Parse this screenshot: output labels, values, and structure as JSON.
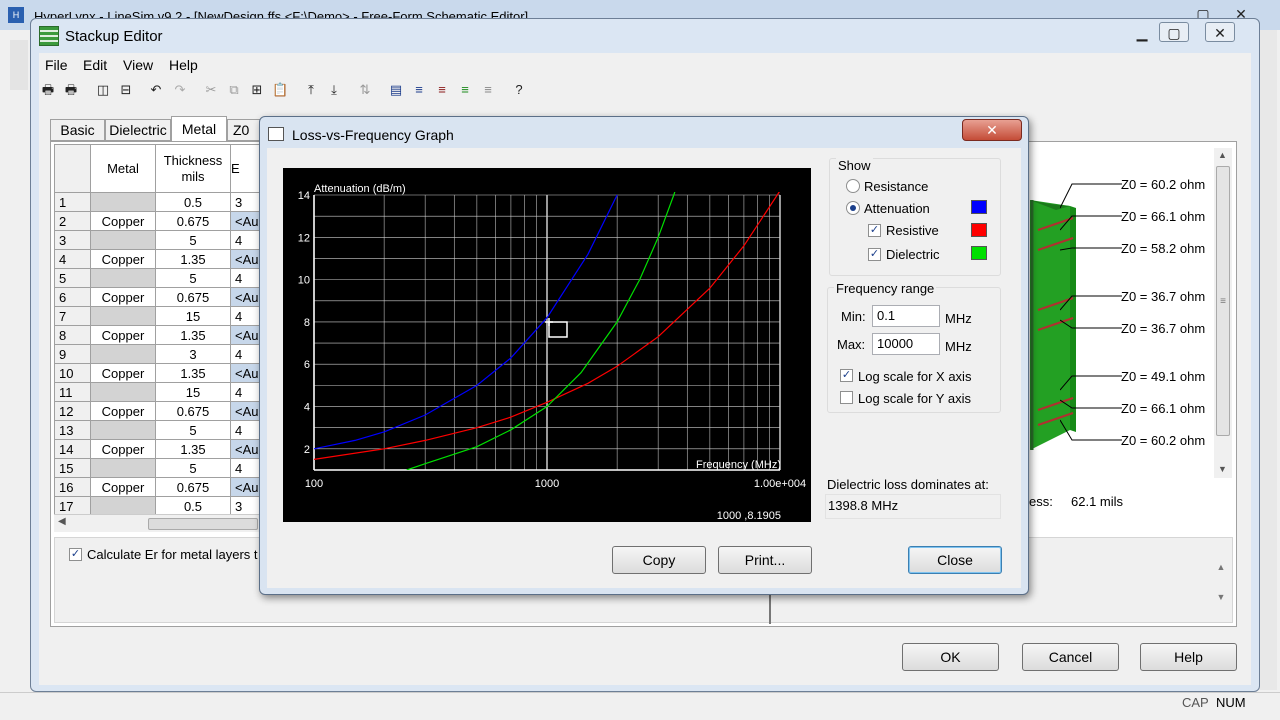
{
  "bg_window": {
    "title": "HyperLynx - LineSim v9.2 - [NewDesign.ffs <F:\\Demo> - Free-Form Schematic Editor]"
  },
  "stackup": {
    "title": "Stackup Editor",
    "menu": [
      "File",
      "Edit",
      "View",
      "Help"
    ],
    "tabs": [
      "Basic",
      "Dielectric",
      "Metal",
      "Z0 P"
    ],
    "active_tab": "Metal",
    "columns": {
      "metal": "Metal",
      "thickness_1": "Thickness",
      "thickness_2": "mils"
    },
    "rows": [
      {
        "n": "1",
        "metal": "",
        "thick": "0.5",
        "er": "3"
      },
      {
        "n": "2",
        "metal": "Copper",
        "thick": "0.675",
        "er": "<Au"
      },
      {
        "n": "3",
        "metal": "",
        "thick": "5",
        "er": "4"
      },
      {
        "n": "4",
        "metal": "Copper",
        "thick": "1.35",
        "er": "<Au"
      },
      {
        "n": "5",
        "metal": "",
        "thick": "5",
        "er": "4"
      },
      {
        "n": "6",
        "metal": "Copper",
        "thick": "0.675",
        "er": "<Au"
      },
      {
        "n": "7",
        "metal": "",
        "thick": "15",
        "er": "4"
      },
      {
        "n": "8",
        "metal": "Copper",
        "thick": "1.35",
        "er": "<Au"
      },
      {
        "n": "9",
        "metal": "",
        "thick": "3",
        "er": "4"
      },
      {
        "n": "10",
        "metal": "Copper",
        "thick": "1.35",
        "er": "<Au"
      },
      {
        "n": "11",
        "metal": "",
        "thick": "15",
        "er": "4"
      },
      {
        "n": "12",
        "metal": "Copper",
        "thick": "0.675",
        "er": "<Au"
      },
      {
        "n": "13",
        "metal": "",
        "thick": "5",
        "er": "4"
      },
      {
        "n": "14",
        "metal": "Copper",
        "thick": "1.35",
        "er": "<Au"
      },
      {
        "n": "15",
        "metal": "",
        "thick": "5",
        "er": "4"
      },
      {
        "n": "16",
        "metal": "Copper",
        "thick": "0.675",
        "er": "<Au"
      },
      {
        "n": "17",
        "metal": "",
        "thick": "0.5",
        "er": "3"
      }
    ],
    "calc_er_label": "Calculate Er for metal layers t",
    "z0_labels": [
      "Z0 = 60.2 ohm",
      "Z0 = 66.1 ohm",
      "Z0 = 58.2 ohm",
      "Z0 = 36.7 ohm",
      "Z0 = 36.7 ohm",
      "Z0 = 49.1 ohm",
      "Z0 = 66.1 ohm",
      "Z0 = 60.2 ohm"
    ],
    "thickness_partial_label": "ess:",
    "thickness_value": "62.1 mils",
    "buttons": {
      "ok": "OK",
      "cancel": "Cancel",
      "help": "Help"
    }
  },
  "status_bar": {
    "cap": "CAP",
    "num": "NUM"
  },
  "dialog": {
    "title": "Loss-vs-Frequency Graph",
    "show_group": "Show",
    "resistance": "Resistance",
    "attenuation": "Attenuation",
    "resistive": "Resistive",
    "dielectric": "Dielectric",
    "freq_group": "Frequency range",
    "min_label": "Min:",
    "min_value": "0.1",
    "min_unit": "MHz",
    "max_label": "Max:",
    "max_value": "10000",
    "max_unit": "MHz",
    "log_x": "Log scale for X axis",
    "log_y": "Log scale for Y axis",
    "dominates_label": "Dielectric loss dominates at:",
    "dominates_value": "1398.8 MHz",
    "buttons": {
      "copy": "Copy",
      "print": "Print...",
      "close": "Close"
    }
  },
  "colors": {
    "attenuation": "#0000ff",
    "resistive": "#ff0000",
    "dielectric": "#00e000"
  },
  "chart_data": {
    "type": "line",
    "ylabel": "Attenuation (dB/m)",
    "xlabel": "Frequency (MHz)",
    "x_scale": "log",
    "xlim": [
      100,
      10000
    ],
    "ylim": [
      1,
      14
    ],
    "x_tick_labels": [
      "100",
      "1000",
      "1.00e+004"
    ],
    "y_tick_labels": [
      "2",
      "4",
      "6",
      "8",
      "10",
      "12",
      "14"
    ],
    "cursor_readout": "1000 ,8.1905",
    "series": [
      {
        "name": "Attenuation",
        "color": "#0000ff",
        "x": [
          100,
          150,
          200,
          300,
          500,
          700,
          1000,
          1500,
          2000
        ],
        "y": [
          2.0,
          2.4,
          2.8,
          3.6,
          5.0,
          6.3,
          8.2,
          11.2,
          14.0
        ]
      },
      {
        "name": "Resistive",
        "color": "#ff0000",
        "x": [
          100,
          200,
          300,
          500,
          700,
          1000,
          1500,
          2000,
          3000,
          5000,
          7000,
          10000
        ],
        "y": [
          1.5,
          2.0,
          2.4,
          3.0,
          3.5,
          4.2,
          5.1,
          5.9,
          7.3,
          9.6,
          11.6,
          14.2
        ]
      },
      {
        "name": "Dielectric",
        "color": "#00e000",
        "x": [
          250,
          300,
          500,
          700,
          1000,
          1400,
          2000,
          2500,
          3000,
          3500,
          4000
        ],
        "y": [
          1.0,
          1.3,
          2.1,
          2.9,
          4.0,
          5.6,
          8.0,
          10.0,
          12.0,
          14.0,
          16.0
        ]
      }
    ]
  }
}
